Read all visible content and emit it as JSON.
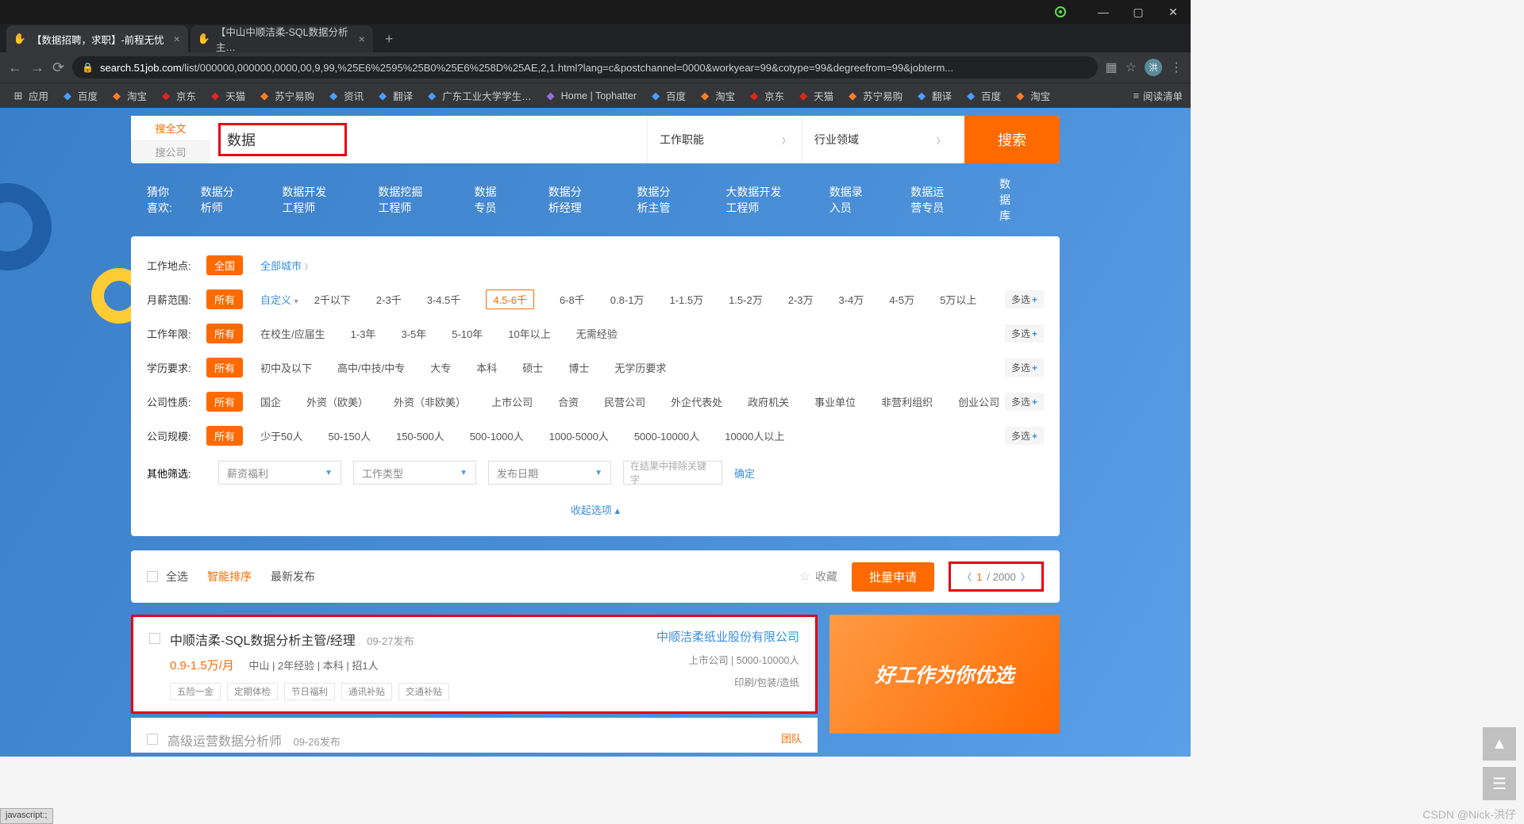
{
  "window": {
    "min": "—",
    "max": "▢",
    "close": "✕"
  },
  "browser": {
    "tabs": [
      {
        "title": "【数据招聘，求职】-前程无忧",
        "fav": "✋"
      },
      {
        "title": "【中山中顺洁柔-SQL数据分析主…",
        "fav": "✋"
      }
    ],
    "url_domain": "search.51job.com",
    "url_path": "/list/000000,000000,0000,00,9,99,%25E6%2595%25B0%25E6%258D%25AE,2,1.html?lang=c&postchannel=0000&workyear=99&cotype=99&degreefrom=99&jobterm...",
    "avatar": "洪",
    "reading_list": "阅读清单",
    "apps": "应用",
    "bookmarks": [
      {
        "t": "百度",
        "c": "b"
      },
      {
        "t": "淘宝",
        "c": "o"
      },
      {
        "t": "京东",
        "c": "r"
      },
      {
        "t": "天猫",
        "c": "r"
      },
      {
        "t": "苏宁易购",
        "c": "o"
      },
      {
        "t": "资讯",
        "c": "b"
      },
      {
        "t": "翻译",
        "c": "b"
      },
      {
        "t": "广东工业大学学生…",
        "c": "b"
      },
      {
        "t": "Home | Tophatter",
        "c": "p"
      },
      {
        "t": "百度",
        "c": "b"
      },
      {
        "t": "淘宝",
        "c": "o"
      },
      {
        "t": "京东",
        "c": "r"
      },
      {
        "t": "天猫",
        "c": "r"
      },
      {
        "t": "苏宁易购",
        "c": "o"
      },
      {
        "t": "翻译",
        "c": "b"
      },
      {
        "t": "百度",
        "c": "b"
      },
      {
        "t": "淘宝",
        "c": "o"
      }
    ]
  },
  "search": {
    "tab_full": "搜全文",
    "tab_company": "搜公司",
    "input": "数据",
    "dd_job": "工作职能",
    "dd_industry": "行业领域",
    "btn": "搜索",
    "suggest_label": "猜你喜欢:",
    "suggest": [
      "数据分析师",
      "数据开发工程师",
      "数据挖掘工程师",
      "数据专员",
      "数据分析经理",
      "数据分析主管",
      "大数据开发工程师",
      "数据录入员",
      "数据运营专员",
      "数据库"
    ]
  },
  "filters": {
    "multi": "多选",
    "plus": "+",
    "loc": {
      "lbl": "工作地点:",
      "all": "全国",
      "link": "全部城市"
    },
    "salary": {
      "lbl": "月薪范围:",
      "all": "所有",
      "custom": "自定义",
      "opts": [
        "2千以下",
        "2-3千",
        "3-4.5千",
        "4.5-6千",
        "6-8千",
        "0.8-1万",
        "1-1.5万",
        "1.5-2万",
        "2-3万",
        "3-4万",
        "4-5万",
        "5万以上"
      ]
    },
    "exp": {
      "lbl": "工作年限:",
      "all": "所有",
      "opts": [
        "在校生/应届生",
        "1-3年",
        "3-5年",
        "5-10年",
        "10年以上",
        "无需经验"
      ]
    },
    "edu": {
      "lbl": "学历要求:",
      "all": "所有",
      "opts": [
        "初中及以下",
        "高中/中技/中专",
        "大专",
        "本科",
        "硕士",
        "博士",
        "无学历要求"
      ]
    },
    "ctype": {
      "lbl": "公司性质:",
      "all": "所有",
      "opts": [
        "国企",
        "外资（欧美）",
        "外资（非欧美）",
        "上市公司",
        "合资",
        "民营公司",
        "外企代表处",
        "政府机关",
        "事业单位",
        "非营利组织",
        "创业公司"
      ]
    },
    "csize": {
      "lbl": "公司规模:",
      "all": "所有",
      "opts": [
        "少于50人",
        "50-150人",
        "150-500人",
        "500-1000人",
        "1000-5000人",
        "5000-10000人",
        "10000人以上"
      ]
    },
    "other": {
      "lbl": "其他筛选:",
      "welfare": "薪资福利",
      "worktype": "工作类型",
      "pubdate": "发布日期",
      "exclude_ph": "在结果中排除关键字",
      "ok": "确定"
    },
    "collapse": "收起选项"
  },
  "sort": {
    "all": "全选",
    "smart": "智能排序",
    "newest": "最新发布",
    "fav": "收藏",
    "apply": "批量申请",
    "page": "1",
    "total": "/ 2000"
  },
  "jobs": [
    {
      "title": "中顺洁柔-SQL数据分析主管/经理",
      "pub": "09-27发布",
      "salary": "0.9-1.5万/月",
      "meta": "中山 | 2年经验 | 本科 | 招1人",
      "tags": [
        "五险一金",
        "定期体检",
        "节日福利",
        "通讯补贴",
        "交通补贴"
      ],
      "company": "中顺洁柔纸业股份有限公司",
      "cinfo": "上市公司 | 5000-10000人",
      "ctype": "印刷/包装/造纸"
    },
    {
      "title": "高级运营数据分析师",
      "pub": "09-26发布",
      "tuandui": "团队"
    }
  ],
  "promo": "好工作为你优选",
  "status": "javascript:;",
  "watermark": "CSDN @Nick-洪仔"
}
